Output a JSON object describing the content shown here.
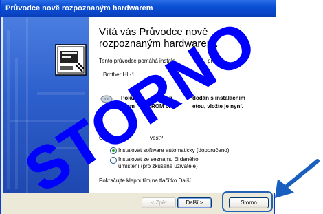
{
  "window": {
    "title": "Průvodce nově rozpoznaným hardwarem"
  },
  "content": {
    "heading": "Vítá vás Průvodce nově rozpoznaným hardwarem.",
    "intro": "Tento průvodce pomáhá instalo",
    "intro_tail": "pro:",
    "device": "Brother HL-1",
    "cd_line1": "Pokud",
    "cd_line1b": "as hn",
    "cd_line1c": "dodán s instalačním",
    "cd_line2": "kem",
    "cd_line2b": "ROM či di",
    "cd_line2c": "etou, vložte je nyní.",
    "question": "Co chcete",
    "question_tail": "vést?",
    "option1": "Instalovat software automaticky (doporučeno)",
    "option2_line1": "Instalovat ze seznamu či daného",
    "option2_line2": "umístění (pro zkušené uživatele)",
    "continue": "Pokračujte klepnutím na tlačítko Další."
  },
  "buttons": {
    "back": "< Zpět",
    "next": "Další >",
    "cancel": "Storno"
  },
  "overlay": {
    "stamp_text": "STORNO",
    "stamp_color": "#0000ff",
    "arrow_color": "#1a5fbf"
  }
}
